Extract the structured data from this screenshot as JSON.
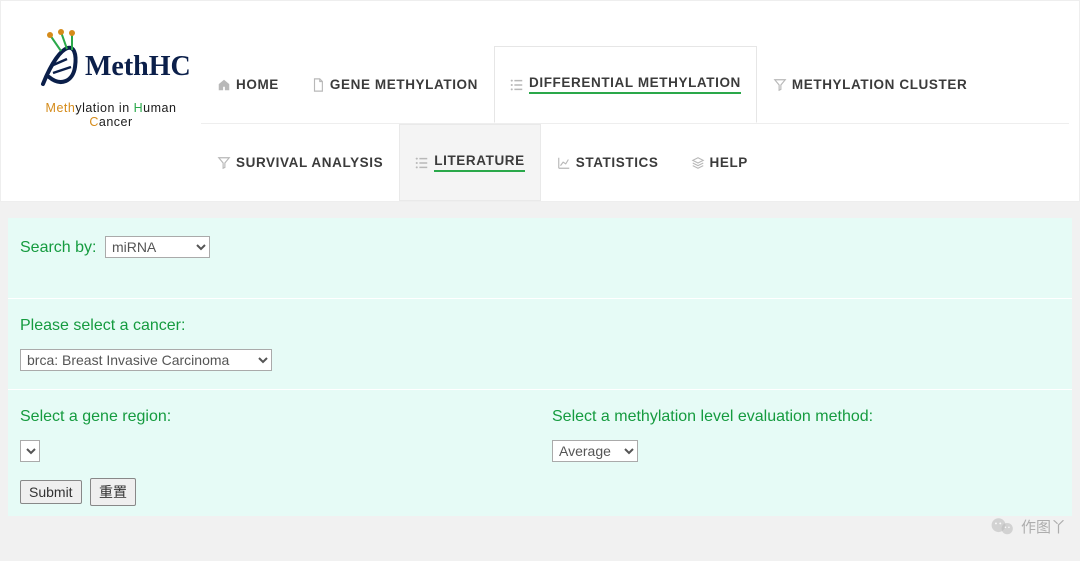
{
  "logo": {
    "text_main": "MethHC",
    "subtitle_parts": {
      "m": "Meth",
      "r1": "ylation in ",
      "h": "H",
      "r2": "uman ",
      "c": "C",
      "r3": "ancer"
    }
  },
  "nav": {
    "row1": [
      {
        "icon": "home",
        "label": "HOME"
      },
      {
        "icon": "doc",
        "label": "GENE METHYLATION"
      },
      {
        "icon": "list",
        "label": "DIFFERENTIAL METHYLATION",
        "active": "primary"
      },
      {
        "icon": "funnel",
        "label": "METHYLATION CLUSTER"
      }
    ],
    "row2": [
      {
        "icon": "funnel",
        "label": "SURVIVAL ANALYSIS"
      },
      {
        "icon": "list",
        "label": "LITERATURE",
        "active": "secondary"
      },
      {
        "icon": "chart",
        "label": "STATISTICS"
      },
      {
        "icon": "stack",
        "label": "HELP"
      }
    ]
  },
  "form": {
    "search_by_label": "Search by:",
    "search_by_value": "miRNA",
    "cancer_label": "Please select a cancer:",
    "cancer_value": "brca: Breast Invasive Carcinoma",
    "region_label": "Select a gene region:",
    "region_value": "",
    "method_label": "Select a methylation level evaluation method:",
    "method_value": "Average",
    "submit": "Submit",
    "reset": "重置"
  },
  "watermark": "作图丫"
}
